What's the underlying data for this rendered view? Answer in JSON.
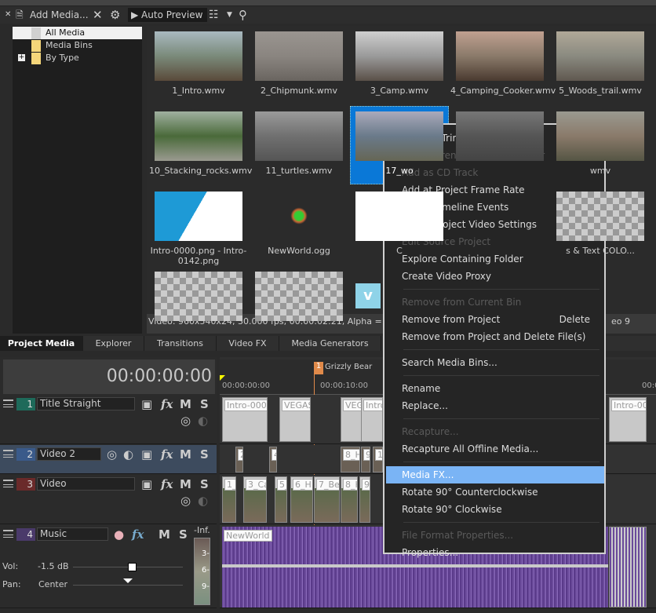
{
  "toolbar": {
    "add_media": "Add Media...",
    "auto_preview": "Auto Preview"
  },
  "tree": [
    {
      "label": "All Media",
      "selected": true
    },
    {
      "label": "Media Bins"
    },
    {
      "label": "By Type",
      "expandable": true
    }
  ],
  "media": [
    {
      "label": "1_Intro.wmv",
      "colors": [
        "#7a8a7a",
        "#a9b9c0",
        "#5a4a3a"
      ]
    },
    {
      "label": "2_Chipmunk.wmv",
      "colors": [
        "#8a8580",
        "#9a9590",
        "#6a6560"
      ]
    },
    {
      "label": "3_Camp.wmv",
      "colors": [
        "#9a9a9a",
        "#cfcfcf",
        "#5a5048"
      ]
    },
    {
      "label": "4_Camping_Cooker.wmv",
      "colors": [
        "#8a7a6a",
        "#c0a090",
        "#4a3a30"
      ]
    },
    {
      "label": "5_Woods_trail.wmv",
      "colors": [
        "#8a8a80",
        "#b0a898",
        "#605850"
      ]
    },
    {
      "label": "10_Stacking_rocks.wmv",
      "colors": [
        "#4a6a3a",
        "#a0b0a0",
        "#9a9a90"
      ]
    },
    {
      "label": "11_turtles.wmv",
      "colors": [
        "#707070",
        "#9a9a9a",
        "#555"
      ]
    },
    {
      "label": "17_wo",
      "colors": [
        "#6a7a8a",
        "#aab",
        "#665"
      ],
      "selected": true
    },
    {
      "label": "",
      "colors": [
        "#555",
        "#777",
        "#444"
      ]
    },
    {
      "label": "wmv",
      "colors": [
        "#8a7a6a",
        "#9a9a90",
        "#554"
      ]
    },
    {
      "label": "Intro-0000.png - Intro-0142.png",
      "colors": [
        "#1e9ad6",
        "#fff",
        "#fff"
      ]
    },
    {
      "label": "NewWorld.ogg",
      "colors": []
    },
    {
      "label": "C",
      "colors": [
        "#fff",
        "#fff",
        "#fff"
      ]
    },
    {
      "label": "",
      "colors": []
    },
    {
      "label": "s & Text COLO...",
      "colors": [
        "checker"
      ]
    }
  ],
  "status": {
    "left": "Video: 960x540x24, 30.000 fps, 00:00:02:21, Alpha = None, I",
    "right": "eo 9"
  },
  "tabs": [
    "Project Media",
    "Explorer",
    "Transitions",
    "Video FX",
    "Media Generators"
  ],
  "timeline": {
    "timecode": "00:00:00:00",
    "marker": {
      "num": "1",
      "label": "Grizzly Bear"
    },
    "ruler": [
      "00:00:00:00",
      "00:00:10:00",
      "00:0"
    ],
    "tracks": [
      {
        "num": "1",
        "name": "Title Straight",
        "color": "#1e6a5a"
      },
      {
        "num": "2",
        "name": "Video 2",
        "color": "#3a5a8a",
        "selected": true
      },
      {
        "num": "3",
        "name": "Video",
        "color": "#6a2a2a"
      },
      {
        "num": "4",
        "name": "Music",
        "color": "#4a3a6a"
      }
    ],
    "buttons": {
      "mute": "M",
      "solo": "S",
      "fx": "fx"
    },
    "audio": {
      "vol_label": "Vol:",
      "vol": "-1.5 dB",
      "pan_label": "Pan:",
      "pan": "Center",
      "meter_top": "-Inf.",
      "meter_ticks": [
        "3-",
        "6-",
        "9-"
      ]
    },
    "clips_t1": [
      "Intro-0000",
      "VEGAS",
      "VEGAS",
      "Intro-000"
    ],
    "clips_t2": [
      "2",
      "4",
      "8_H",
      "9",
      "10"
    ],
    "clips_t3": [
      "1_",
      "3_Ca",
      "5_W",
      "6_H",
      "7_Bea",
      "8_H",
      "9"
    ],
    "clip_t4": "NewWorld"
  },
  "menu": [
    {
      "label": "Open in Trimmer"
    },
    {
      "label": "Open Parent Media in Trimmer",
      "disabled": true
    },
    {
      "label": "Add as CD Track",
      "disabled": true
    },
    {
      "label": "Add at Project Frame Rate"
    },
    {
      "label": "Select Timeline Events"
    },
    {
      "label": "Match Project Video Settings"
    },
    {
      "label": "Edit Source Project",
      "disabled": true
    },
    {
      "label": "Explore Containing Folder"
    },
    {
      "label": "Create Video Proxy",
      "sep_after": true
    },
    {
      "label": "Remove from Current Bin",
      "disabled": true
    },
    {
      "label": "Remove from Project",
      "shortcut": "Delete"
    },
    {
      "label": "Remove from Project and Delete File(s)",
      "sep_after": true
    },
    {
      "label": "Search Media Bins...",
      "sep_after": true
    },
    {
      "label": "Rename"
    },
    {
      "label": "Replace...",
      "sep_after": true
    },
    {
      "label": "Recapture...",
      "disabled": true
    },
    {
      "label": "Recapture All Offline Media...",
      "sep_after": true
    },
    {
      "label": "Media FX...",
      "highlighted": true
    },
    {
      "label": "Rotate 90° Counterclockwise"
    },
    {
      "label": "Rotate 90° Clockwise",
      "sep_after": true
    },
    {
      "label": "File Format Properties...",
      "disabled": true
    },
    {
      "label": "Properties..."
    }
  ]
}
